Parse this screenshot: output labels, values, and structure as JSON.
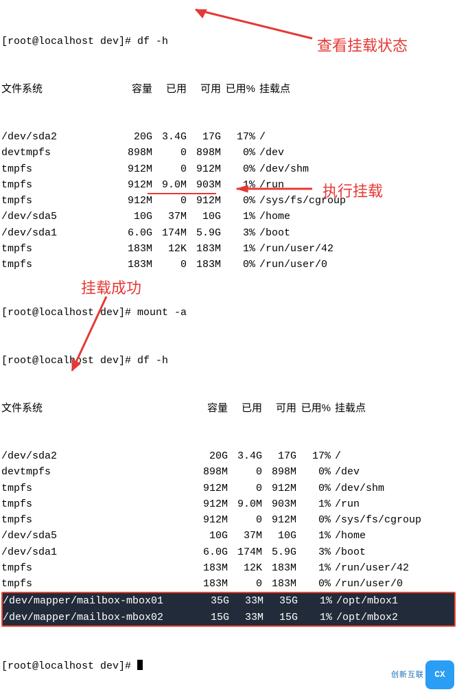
{
  "prompt1": "[root@localhost dev]# df -h",
  "header1": {
    "fs": "文件系统",
    "size": "容量",
    "used": "已用",
    "avail": "可用",
    "pct": "已用%",
    "mount": "挂载点"
  },
  "df1": [
    {
      "fs": "/dev/sda2",
      "size": "20G",
      "used": "3.4G",
      "avail": "17G",
      "pct": "17%",
      "mount": "/"
    },
    {
      "fs": "devtmpfs",
      "size": "898M",
      "used": "0",
      "avail": "898M",
      "pct": "0%",
      "mount": "/dev"
    },
    {
      "fs": "tmpfs",
      "size": "912M",
      "used": "0",
      "avail": "912M",
      "pct": "0%",
      "mount": "/dev/shm"
    },
    {
      "fs": "tmpfs",
      "size": "912M",
      "used": "9.0M",
      "avail": "903M",
      "pct": "1%",
      "mount": "/run"
    },
    {
      "fs": "tmpfs",
      "size": "912M",
      "used": "0",
      "avail": "912M",
      "pct": "0%",
      "mount": "/sys/fs/cgroup"
    },
    {
      "fs": "/dev/sda5",
      "size": "10G",
      "used": "37M",
      "avail": "10G",
      "pct": "1%",
      "mount": "/home"
    },
    {
      "fs": "/dev/sda1",
      "size": "6.0G",
      "used": "174M",
      "avail": "5.9G",
      "pct": "3%",
      "mount": "/boot"
    },
    {
      "fs": "tmpfs",
      "size": "183M",
      "used": "12K",
      "avail": "183M",
      "pct": "1%",
      "mount": "/run/user/42"
    },
    {
      "fs": "tmpfs",
      "size": "183M",
      "used": "0",
      "avail": "183M",
      "pct": "0%",
      "mount": "/run/user/0"
    }
  ],
  "prompt2": "[root@localhost dev]# mount -a",
  "prompt3": "[root@localhost dev]# df -h",
  "header2": {
    "fs": "文件系统",
    "size": "容量",
    "used": "已用",
    "avail": "可用",
    "pct": "已用%",
    "mount": "挂载点"
  },
  "df2": [
    {
      "fs": "/dev/sda2",
      "size": "20G",
      "used": "3.4G",
      "avail": "17G",
      "pct": "17%",
      "mount": "/"
    },
    {
      "fs": "devtmpfs",
      "size": "898M",
      "used": "0",
      "avail": "898M",
      "pct": "0%",
      "mount": "/dev"
    },
    {
      "fs": "tmpfs",
      "size": "912M",
      "used": "0",
      "avail": "912M",
      "pct": "0%",
      "mount": "/dev/shm"
    },
    {
      "fs": "tmpfs",
      "size": "912M",
      "used": "9.0M",
      "avail": "903M",
      "pct": "1%",
      "mount": "/run"
    },
    {
      "fs": "tmpfs",
      "size": "912M",
      "used": "0",
      "avail": "912M",
      "pct": "0%",
      "mount": "/sys/fs/cgroup"
    },
    {
      "fs": "/dev/sda5",
      "size": "10G",
      "used": "37M",
      "avail": "10G",
      "pct": "1%",
      "mount": "/home"
    },
    {
      "fs": "/dev/sda1",
      "size": "6.0G",
      "used": "174M",
      "avail": "5.9G",
      "pct": "3%",
      "mount": "/boot"
    },
    {
      "fs": "tmpfs",
      "size": "183M",
      "used": "12K",
      "avail": "183M",
      "pct": "1%",
      "mount": "/run/user/42"
    },
    {
      "fs": "tmpfs",
      "size": "183M",
      "used": "0",
      "avail": "183M",
      "pct": "0%",
      "mount": "/run/user/0"
    },
    {
      "fs": "/dev/mapper/mailbox-mbox01",
      "size": "35G",
      "used": "33M",
      "avail": "35G",
      "pct": "1%",
      "mount": "/opt/mbox1"
    },
    {
      "fs": "/dev/mapper/mailbox-mbox02",
      "size": "15G",
      "used": "33M",
      "avail": "15G",
      "pct": "1%",
      "mount": "/opt/mbox2"
    }
  ],
  "prompt4": "[root@localhost dev]# ",
  "anno": {
    "check_mount": "查看挂载状态",
    "exec_mount": "执行挂载",
    "mount_ok": "挂载成功"
  },
  "logo_text": "创新互联"
}
